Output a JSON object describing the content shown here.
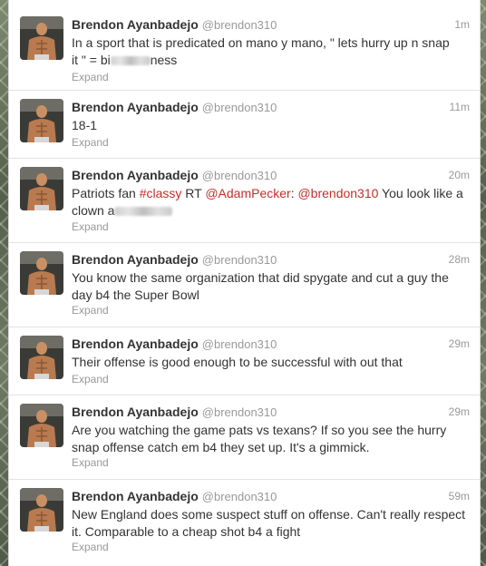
{
  "colors": {
    "link": "#c0302b",
    "name": "#333333",
    "muted": "#999999"
  },
  "tweets": [
    {
      "name": "Brendon Ayanbadejo",
      "handle": "@brendon310",
      "time": "1m",
      "line1": "In a sport that is predicated on mano y mano, \" lets hurry up n snap",
      "line2_a": "it \" = bi",
      "line2_b": "ness",
      "expand": "Expand"
    },
    {
      "name": "Brendon Ayanbadejo",
      "handle": "@brendon310",
      "time": "11m",
      "text": "18-1",
      "expand": "Expand"
    },
    {
      "name": "Brendon Ayanbadejo",
      "handle": "@brendon310",
      "time": "20m",
      "prefix": "Patriots fan ",
      "hashtag": "#classy",
      "rt": " RT ",
      "mention1": "@AdamPecker",
      "colon": ": ",
      "mention2": "@brendon310",
      "suffix": " You look like a",
      "line2_a": "clown a",
      "expand": "Expand"
    },
    {
      "name": "Brendon Ayanbadejo",
      "handle": "@brendon310",
      "time": "28m",
      "text": "You know the same organization that did spygate and cut a guy the day b4 the Super Bowl",
      "expand": "Expand"
    },
    {
      "name": "Brendon Ayanbadejo",
      "handle": "@brendon310",
      "time": "29m",
      "text": "Their offense is good enough to be successful with out that",
      "expand": "Expand"
    },
    {
      "name": "Brendon Ayanbadejo",
      "handle": "@brendon310",
      "time": "29m",
      "text": "Are you watching the game pats vs texans? If so you see the hurry snap offense catch em b4 they set up. It's a gimmick.",
      "expand": "Expand"
    },
    {
      "name": "Brendon Ayanbadejo",
      "handle": "@brendon310",
      "time": "59m",
      "text": "New England does some suspect stuff on offense. Can't really respect it. Comparable to a cheap shot b4 a fight",
      "expand": "Expand"
    }
  ]
}
